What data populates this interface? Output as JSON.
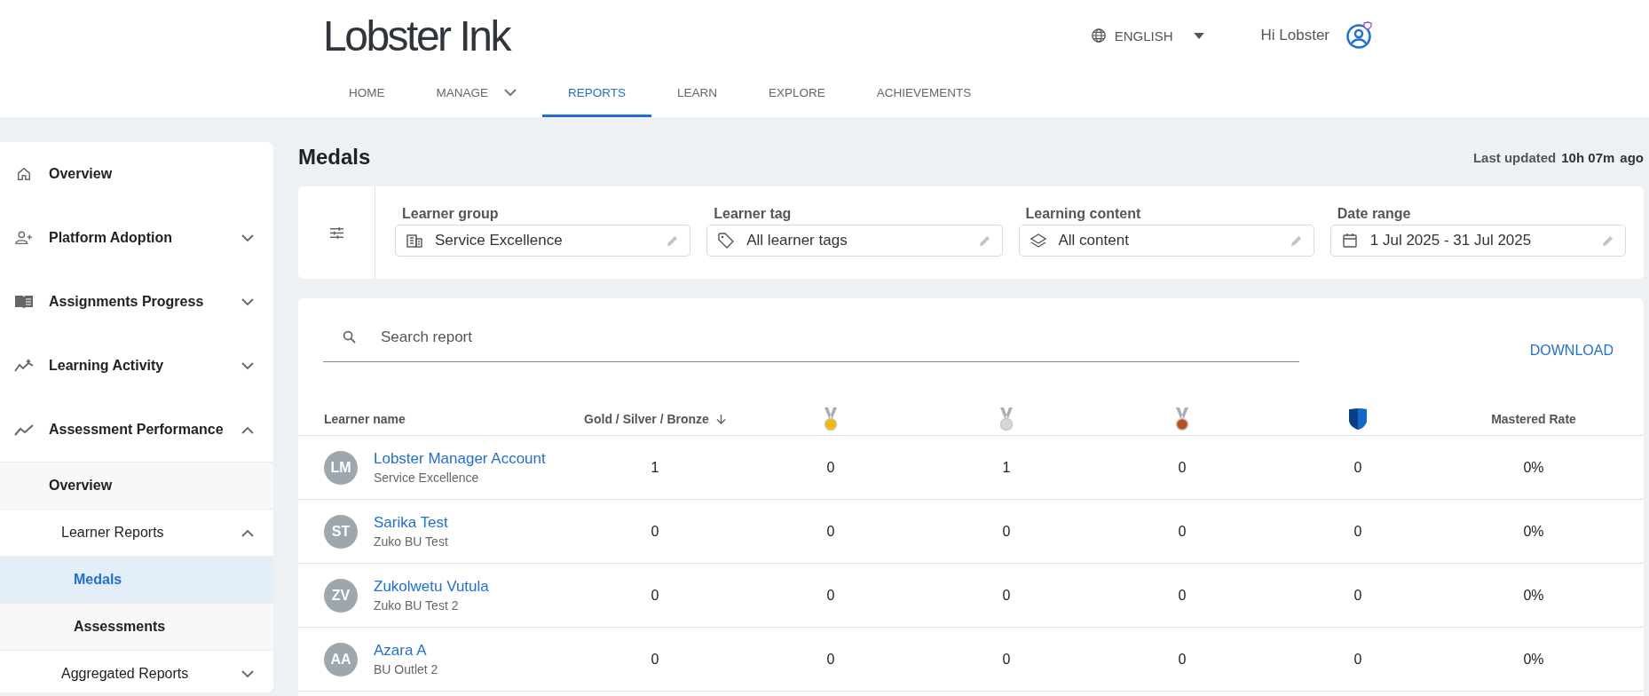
{
  "header": {
    "logo": "Lobster Ink",
    "language": "ENGLISH",
    "greeting": "Hi Lobster"
  },
  "nav_tabs": [
    {
      "label": "HOME",
      "selected": false,
      "has_menu": false
    },
    {
      "label": "MANAGE",
      "selected": false,
      "has_menu": true
    },
    {
      "label": "REPORTS",
      "selected": true,
      "has_menu": false
    },
    {
      "label": "LEARN",
      "selected": false,
      "has_menu": false
    },
    {
      "label": "EXPLORE",
      "selected": false,
      "has_menu": false
    },
    {
      "label": "ACHIEVEMENTS",
      "selected": false,
      "has_menu": false
    }
  ],
  "sidebar": {
    "items": [
      {
        "label": "Overview",
        "selected": false
      },
      {
        "label": "Platform Adoption",
        "selected": false,
        "expanded": false
      },
      {
        "label": "Assignments Progress",
        "selected": false,
        "expanded": false
      },
      {
        "label": "Learning Activity",
        "selected": false,
        "expanded": false
      },
      {
        "label": "Assessment Performance",
        "selected": false,
        "expanded": true,
        "children": [
          {
            "label": "Overview",
            "selected": false
          },
          {
            "label": "Learner Reports",
            "selected": false,
            "expanded": true,
            "children": [
              {
                "label": "Medals",
                "selected": true
              },
              {
                "label": "Assessments",
                "selected": false
              }
            ]
          },
          {
            "label": "Aggregated Reports",
            "selected": false,
            "expanded": false
          }
        ]
      }
    ]
  },
  "page": {
    "title": "Medals",
    "last_updated_label": "Last updated",
    "last_updated_value": "10h 07m",
    "last_updated_suffix": "ago"
  },
  "filters": [
    {
      "label": "Learner group",
      "value": "Service Excellence"
    },
    {
      "label": "Learner tag",
      "value": "All learner tags"
    },
    {
      "label": "Learning content",
      "value": "All content"
    },
    {
      "label": "Date range",
      "value": "1 Jul 2025 - 31 Jul 2025"
    }
  ],
  "search": {
    "placeholder": "Search report"
  },
  "download": "DOWNLOAD",
  "table": {
    "columns": [
      {
        "kind": "text",
        "label": "Learner name"
      },
      {
        "kind": "sort",
        "label": "Gold / Silver / Bronze"
      },
      {
        "kind": "gold"
      },
      {
        "kind": "silver"
      },
      {
        "kind": "bronze"
      },
      {
        "kind": "shield"
      },
      {
        "kind": "text",
        "label": "Mastered Rate"
      }
    ],
    "rows": [
      {
        "initials": "LM",
        "name": "Lobster Manager Account",
        "group": "Service Excellence",
        "values": [
          "1",
          "0",
          "1",
          "0",
          "0",
          "0%"
        ]
      },
      {
        "initials": "ST",
        "name": "Sarika Test",
        "group": "Zuko BU Test",
        "values": [
          "0",
          "0",
          "0",
          "0",
          "0",
          "0%"
        ]
      },
      {
        "initials": "ZV",
        "name": "Zukolwetu Vutula",
        "group": "Zuko BU Test 2",
        "values": [
          "0",
          "0",
          "0",
          "0",
          "0",
          "0%"
        ]
      },
      {
        "initials": "AA",
        "name": "Azara A",
        "group": "BU Outlet 2",
        "values": [
          "0",
          "0",
          "0",
          "0",
          "0",
          "0%"
        ]
      }
    ]
  }
}
